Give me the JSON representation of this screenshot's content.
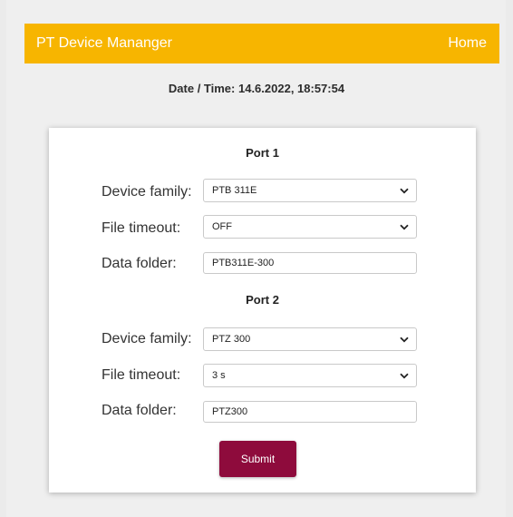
{
  "header": {
    "title": "PT Device Mananger",
    "home_label": "Home",
    "bg_color": "#f7b500"
  },
  "datetime": "Date / Time: 14.6.2022, 18:57:54",
  "ports": [
    {
      "title": "Port 1",
      "device_family_label": "Device family:",
      "device_family_value": "PTB 311E",
      "file_timeout_label": "File timeout:",
      "file_timeout_value": "OFF",
      "data_folder_label": "Data folder:",
      "data_folder_value": "PTB311E-300"
    },
    {
      "title": "Port 2",
      "device_family_label": "Device family:",
      "device_family_value": "PTZ 300",
      "file_timeout_label": "File timeout:",
      "file_timeout_value": "3 s",
      "data_folder_label": "Data folder:",
      "data_folder_value": "PTZ300"
    }
  ],
  "form": {
    "submit_label": "Submit",
    "submit_color": "#8e0b3c"
  },
  "icons": {
    "select_arrow": "chevron-down-icon"
  }
}
